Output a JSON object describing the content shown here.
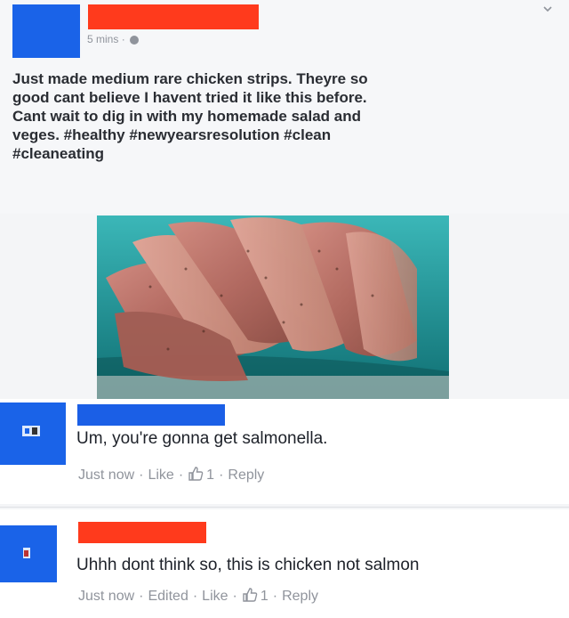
{
  "post": {
    "timestamp": "5 mins",
    "dot": "·",
    "text": "Just made medium rare chicken strips. Theyre so\ngood cant believe I havent tried it like this before.\nCant wait to dig in with my homemade salad and\nveges. #healthy #newyearsresolution #clean\n#cleaneating"
  },
  "comments": [
    {
      "text": "Um, you're gonna get salmonella.",
      "actions": {
        "time": "Just now",
        "like": "Like",
        "count": "1",
        "reply": "Reply"
      }
    },
    {
      "text": "Uhhh dont think so, this is chicken not salmon",
      "actions": {
        "time": "Just now",
        "edited": "Edited",
        "like": "Like",
        "count": "1",
        "reply": "Reply"
      }
    }
  ],
  "colors": {
    "redaction_blue": "#1a63e8",
    "redaction_red": "#ff3a1c",
    "meta_gray": "#90949c"
  }
}
